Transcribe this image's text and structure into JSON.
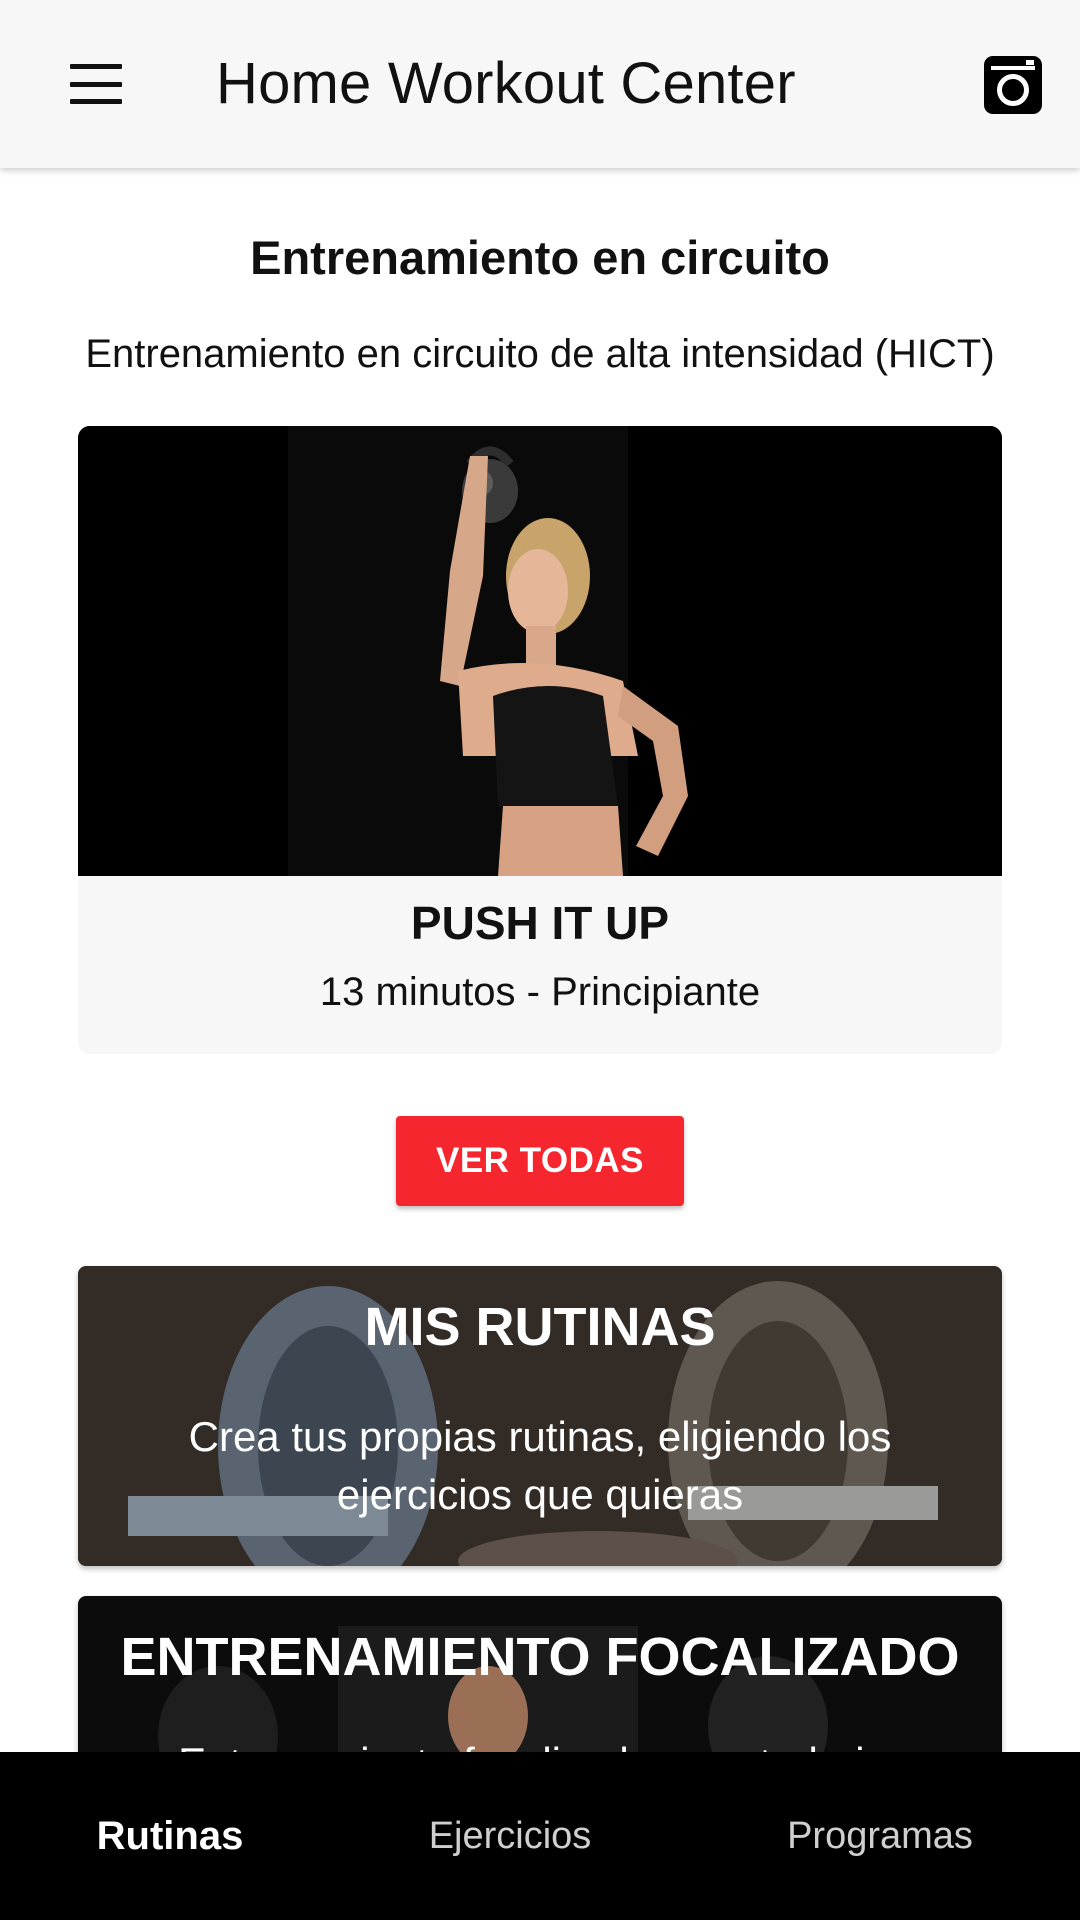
{
  "header": {
    "title": "Home Workout Center",
    "menu_icon": "hamburger-menu-icon",
    "right_icon": "instagram-camera-icon"
  },
  "section": {
    "title": "Entrenamiento en circuito",
    "subtitle": "Entrenamiento en circuito de alta intensidad (HICT)"
  },
  "featured_routine": {
    "name": "PUSH IT UP",
    "meta": "13 minutos - Principiante",
    "image": "woman-with-kettlebell-photo"
  },
  "see_all_label": "VER TODAS",
  "banners": [
    {
      "title": "MIS RUTINAS",
      "description": "Crea tus propias rutinas, eligiendo los ejercicios que quieras",
      "image": "dumbbells-photo"
    },
    {
      "title": "ENTRENAMIENTO FOCALIZADO",
      "description": "Entrenamiento focalizado para trabajar",
      "image": "gym-man-photo"
    }
  ],
  "bottom_nav": {
    "items": [
      {
        "label": "Rutinas",
        "active": true
      },
      {
        "label": "Ejercicios",
        "active": false
      },
      {
        "label": "Programas",
        "active": false
      }
    ]
  },
  "colors": {
    "accent": "#f6262e",
    "appbar_bg": "#f7f7f7",
    "bottom_nav_bg": "#000000"
  }
}
